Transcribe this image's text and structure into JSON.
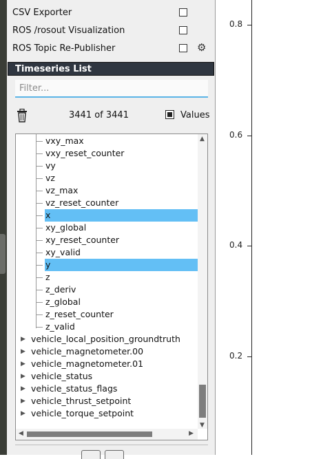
{
  "plugins": [
    {
      "label": "CSV Exporter",
      "checked": false,
      "has_settings": false
    },
    {
      "label": "ROS /rosout Visualization",
      "checked": false,
      "has_settings": false
    },
    {
      "label": "ROS Topic Re-Publisher",
      "checked": false,
      "has_settings": true
    }
  ],
  "timeseries": {
    "title": "Timeseries List",
    "filter_placeholder": "Filter...",
    "count": "3441 of 3441",
    "values_label": "Values",
    "values_checked": true
  },
  "tree": {
    "children": [
      {
        "label": "vxy_max",
        "selected": false
      },
      {
        "label": "vxy_reset_counter",
        "selected": false
      },
      {
        "label": "vy",
        "selected": false
      },
      {
        "label": "vz",
        "selected": false
      },
      {
        "label": "vz_max",
        "selected": false
      },
      {
        "label": "vz_reset_counter",
        "selected": false
      },
      {
        "label": "x",
        "selected": true
      },
      {
        "label": "xy_global",
        "selected": false
      },
      {
        "label": "xy_reset_counter",
        "selected": false
      },
      {
        "label": "xy_valid",
        "selected": false
      },
      {
        "label": "y",
        "selected": true
      },
      {
        "label": "z",
        "selected": false
      },
      {
        "label": "z_deriv",
        "selected": false
      },
      {
        "label": "z_global",
        "selected": false
      },
      {
        "label": "z_reset_counter",
        "selected": false
      },
      {
        "label": "z_valid",
        "selected": false
      }
    ],
    "topics": [
      "vehicle_local_position_groundtruth",
      "vehicle_magnetometer.00",
      "vehicle_magnetometer.01",
      "vehicle_status",
      "vehicle_status_flags",
      "vehicle_thrust_setpoint",
      "vehicle_torque_setpoint"
    ]
  },
  "plot": {
    "y_ticks": [
      "0.8",
      "0.6",
      "0.4",
      "0.2"
    ],
    "y_tick_values": [
      0.8,
      0.6,
      0.4,
      0.2
    ]
  }
}
